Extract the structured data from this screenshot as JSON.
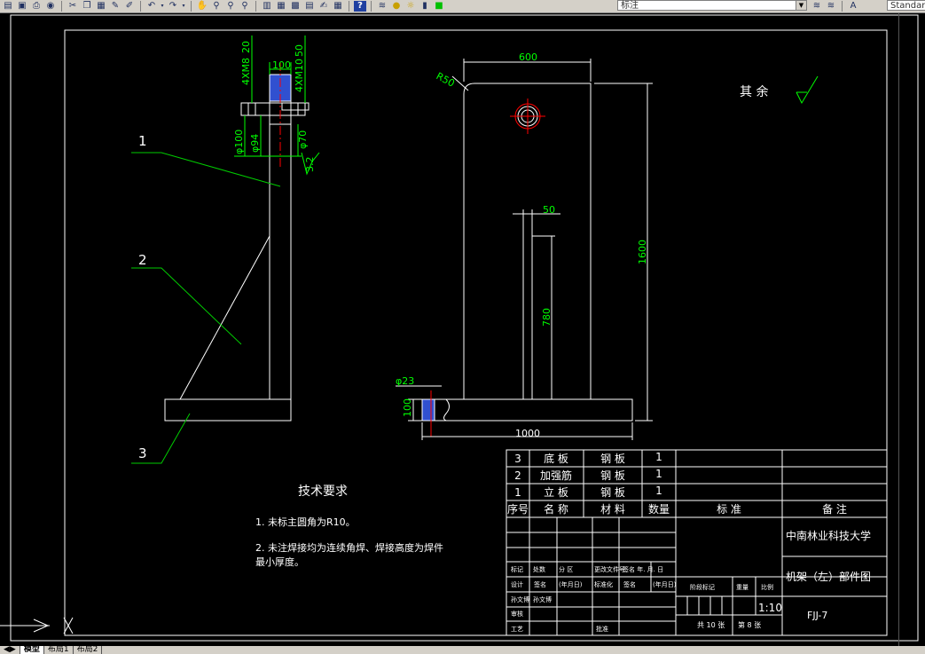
{
  "toolbar": {
    "layer_combo": "标注",
    "style_combo": "Standar",
    "icons": [
      "open-icon",
      "save-icon",
      "print-icon",
      "plot-icon",
      "cut-icon",
      "copy-icon",
      "paste-icon",
      "match-properties-icon",
      "undo-icon",
      "redo-icon",
      "pan-icon",
      "zoom-realtime-icon",
      "zoom-window-icon",
      "zoom-previous-icon",
      "properties-icon",
      "design-center-icon",
      "tool-palette-icon",
      "sheet-set-icon",
      "markup-icon",
      "calculator-icon",
      "help-icon",
      "layer-manager-icon",
      "layer-state-icon"
    ]
  },
  "tabs": [
    "模型",
    "布局1",
    "布局2"
  ],
  "colors": {
    "background": "#000000",
    "line": "#ffffff",
    "dimension": "#00ff00",
    "leader": "#00cc00",
    "centerline": "#ff0000",
    "hatch": "#3050d0",
    "toolbar": "#d4d0c8"
  },
  "drawing": {
    "dims": {
      "d100_top": "100",
      "x4m8": "4XM8",
      "x4m8_depth": "20",
      "x4m10": "4XM10",
      "x4m10_depth": "50",
      "phi100": "φ100",
      "phi94": "φ94",
      "phi70": "φ70",
      "roughness": "3.2",
      "w600": "600",
      "r50": "R50",
      "h1600": "1600",
      "w50": "50",
      "h780": "780",
      "phi23": "φ23",
      "t100": "100",
      "w1000": "1000"
    },
    "balloons": [
      "1",
      "2",
      "3"
    ],
    "surface_note": "其 余"
  },
  "tech": {
    "title": "技术要求",
    "note1": "1. 未标主圆角为R10。",
    "note2a": "2. 未注焊接均为连续角焊、焊接高度为焊件",
    "note2b": "最小厚度。"
  },
  "bom": {
    "rows": [
      {
        "no": "3",
        "name": "底  板",
        "material": "钢  板",
        "qty": "1"
      },
      {
        "no": "2",
        "name": "加强筋",
        "material": "钢  板",
        "qty": "1"
      },
      {
        "no": "1",
        "name": "立  板",
        "material": "钢  板",
        "qty": "1"
      }
    ],
    "header": {
      "no": "序号",
      "name": "名  称",
      "material": "材  料",
      "qty": "数量",
      "std": "标      准",
      "note": "备    注"
    }
  },
  "titleblock": {
    "school": "中南林业科技大学",
    "drawing_name": "机架（左）部件图",
    "code": "FJJ-7",
    "scale": "1:10",
    "sheets_total": "共 10 张",
    "sheet_no": "第 8 张",
    "labels": {
      "mark": "标记",
      "count": "处数",
      "zone": "分 区",
      "change_doc": "更改文件号",
      "sign_date": "签名  年. 月. 日",
      "design": "设计",
      "sign1": "签名",
      "ymd1": "(年月日)",
      "standardize": "标准化",
      "sign2": "签名",
      "ymd2": "(年月日)",
      "stage": "阶段标记",
      "weight": "重量",
      "ratio": "比例",
      "d1": "孙文博",
      "d2": "孙文博",
      "review": "审核",
      "process": "工艺",
      "approve": "批准"
    }
  }
}
